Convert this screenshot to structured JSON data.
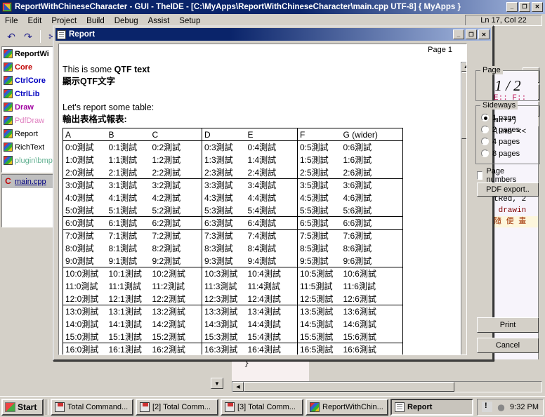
{
  "ide": {
    "title": "ReportWithChineseCharacter - GUI - TheIDE - [C:\\MyApps\\ReportWithChineseCharacter\\main.cpp UTF-8] { MyApps }",
    "window_buttons": [
      "_",
      "❐",
      "✕"
    ],
    "menu": [
      "File",
      "Edit",
      "Project",
      "Build",
      "Debug",
      "Assist",
      "Setup"
    ],
    "status_lncol": "Ln 17, Col 22",
    "toolbar_icons": [
      "undo-icon",
      "redo-icon",
      "cut-icon"
    ],
    "toolbar_glyphs": [
      "↶",
      "↷",
      "✂"
    ],
    "packages": [
      {
        "label": "ReportWi",
        "color": "#000000",
        "bold": true
      },
      {
        "label": "Core",
        "color": "#c00000",
        "bold": true
      },
      {
        "label": "CtrlCore",
        "color": "#0000c0",
        "bold": true
      },
      {
        "label": "CtrlLib",
        "color": "#0000c0",
        "bold": true
      },
      {
        "label": "Draw",
        "color": "#a000a0",
        "bold": true
      },
      {
        "label": "PdfDraw",
        "color": "#e080c0",
        "bold": false
      },
      {
        "label": "Report",
        "color": "#000000",
        "bold": false
      },
      {
        "label": "RichText",
        "color": "#000000",
        "bold": false
      },
      {
        "label": "plugin\\bmp",
        "color": "#60b090",
        "bold": false
      }
    ],
    "files": [
      {
        "label": "main.cpp"
      }
    ],
    "code_lines": [
      "",
      "",
      "E:: F::",
      "",
      "mn++)",
      "lumn <<",
      "",
      "",
      "",
      "",
      "",
      "tRed, 2",
      " drawin",
      "隨 便 畫"
    ],
    "bottom_code": "}"
  },
  "dialog": {
    "title": "Report",
    "window_buttons": [
      "_",
      "❐",
      "✕"
    ],
    "page_label": "Page 1",
    "doc": {
      "line1_plain": "This is some ",
      "line1_bold": "QTF text",
      "line2": "顯示QTF文字",
      "line3": "Let's report some table:",
      "line4": "輸出表格式報表:"
    },
    "table": {
      "headers": [
        "A",
        "B",
        "C",
        "D",
        "E",
        "F",
        "G (wider)"
      ],
      "suffix": "測試",
      "row_count": 17,
      "col_count": 7,
      "group_end_rows": [
        2,
        5,
        6,
        9,
        12,
        15
      ]
    },
    "page_group": {
      "label": "Page",
      "value": "1 / 2"
    },
    "sideways_group": {
      "label": "Sideways",
      "options": [
        {
          "label": "1 page",
          "selected": true
        },
        {
          "label": "2 pages",
          "selected": false
        },
        {
          "label": "4 pages",
          "selected": false
        },
        {
          "label": "8 pages",
          "selected": false
        }
      ]
    },
    "page_numbers": {
      "label": "Page numbers",
      "checked": false
    },
    "buttons": {
      "pdf_export": "PDF export..",
      "print": "Print",
      "cancel": "Cancel"
    }
  },
  "taskbar": {
    "start": "Start",
    "items": [
      {
        "label": "Total Command...",
        "icon": "floppy",
        "active": false
      },
      {
        "label": "[2] Total Comm...",
        "icon": "floppy",
        "active": false
      },
      {
        "label": "[3] Total Comm...",
        "icon": "floppy",
        "active": false
      },
      {
        "label": "ReportWithChin...",
        "icon": "pkg",
        "active": false
      },
      {
        "label": "Report",
        "icon": "rep",
        "active": true
      }
    ],
    "clock": "9:32 PM"
  }
}
